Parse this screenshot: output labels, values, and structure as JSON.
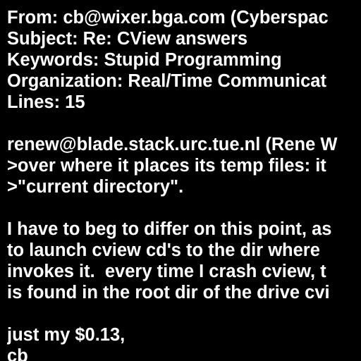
{
  "message": {
    "headers": {
      "from": "From: cb@wixer.bga.com (Cyberspac",
      "subject": "Subject: Re: CView answers",
      "keywords": "Keywords: Stupid Programming",
      "organization": "Organization: Real/Time Communicat",
      "lines": "Lines: 15"
    },
    "quote": [
      "renew@blade.stack.urc.tue.nl (Rene W",
      ">over where it places its temp files: it",
      ">\"current directory\"."
    ],
    "body": [
      "I have to beg to differ on this point, as",
      "to launch cview cd's to the dir where",
      "invokes it.  every time I crash cview, t",
      "is found in the root dir of the drive cvi"
    ],
    "signature": [
      "just my $0.13,",
      "cb"
    ]
  },
  "colors": {
    "background": "#000000",
    "text": "#ffffff"
  }
}
